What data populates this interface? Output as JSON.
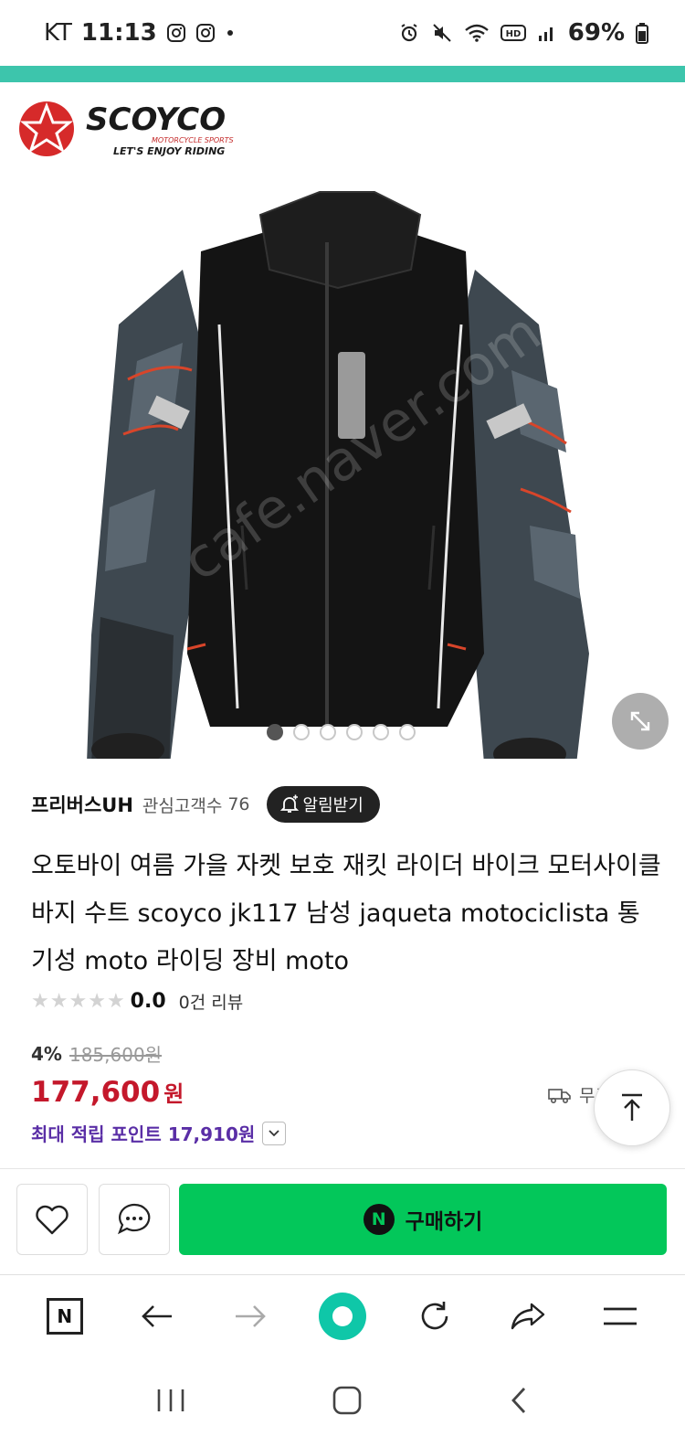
{
  "status_bar": {
    "carrier": "KT",
    "time": "11:13",
    "battery": "69%",
    "icons": [
      "instagram-icon",
      "instagram-icon",
      "dot-icon",
      "alarm-icon",
      "mute-icon",
      "wifi-icon",
      "hd-icon",
      "signal-icon",
      "battery-icon"
    ]
  },
  "gallery": {
    "brand": "SCOYCO",
    "brand_sub": "MOTORCYCLE SPORTS",
    "brand_tagline": "LET'S ENJOY RIDING",
    "watermark": "cafe.naver.com/joonggonara",
    "image_count": 6,
    "active_index": 0
  },
  "store": {
    "name": "프리버스UH",
    "follower_label": "관심고객수",
    "follower_count": "76",
    "notify_label": "알림받기"
  },
  "product": {
    "title": "오토바이 여름 가을 자켓 보호 재킷 라이더 바이크 모터사이클 바지 수트 scoyco jk117 남성 jaqueta motociclista 통기성 moto 라이딩 장비 moto",
    "rating": "0.0",
    "rating_fraction": 0,
    "review_count": "0건 리뷰",
    "discount_rate": "4%",
    "original_price": "185,600원",
    "sale_price": "177,600",
    "currency": "원",
    "point_text": "최대 적립 포인트 17,910원",
    "shipping": "무료"
  },
  "actions": {
    "buy_label": "구매하기",
    "npay_label": "N"
  },
  "browser": {
    "home_label": "N"
  },
  "colors": {
    "accent": "#3dc5ac",
    "price_red": "#c4182b",
    "point_purple": "#5a2ea6",
    "buy_green": "#03c75a"
  }
}
